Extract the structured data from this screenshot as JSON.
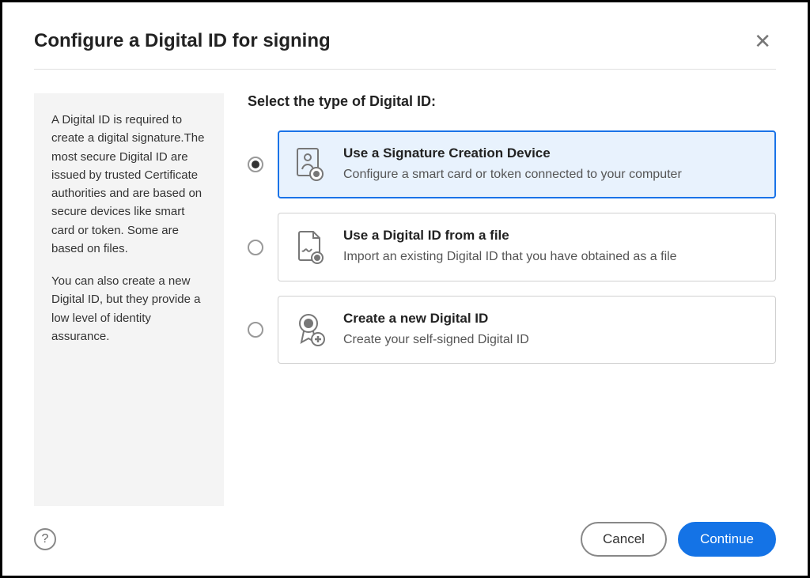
{
  "dialog": {
    "title": "Configure a Digital ID for signing"
  },
  "sidebar": {
    "paragraph1": "A Digital ID is required to create a digital signature.The most secure Digital ID are issued by trusted Certificate authorities and are based on secure devices like smart card or token. Some are based on files.",
    "paragraph2": "You can also create a new Digital ID, but they provide a low level of identity assurance."
  },
  "main": {
    "section_label": "Select the type of Digital ID:",
    "options": [
      {
        "title": "Use a Signature Creation Device",
        "desc": "Configure a smart card or token connected to your computer"
      },
      {
        "title": "Use a Digital ID from a file",
        "desc": "Import an existing Digital ID that you have obtained as a file"
      },
      {
        "title": "Create a new Digital ID",
        "desc": "Create your self-signed Digital ID"
      }
    ]
  },
  "footer": {
    "cancel": "Cancel",
    "continue": "Continue"
  }
}
